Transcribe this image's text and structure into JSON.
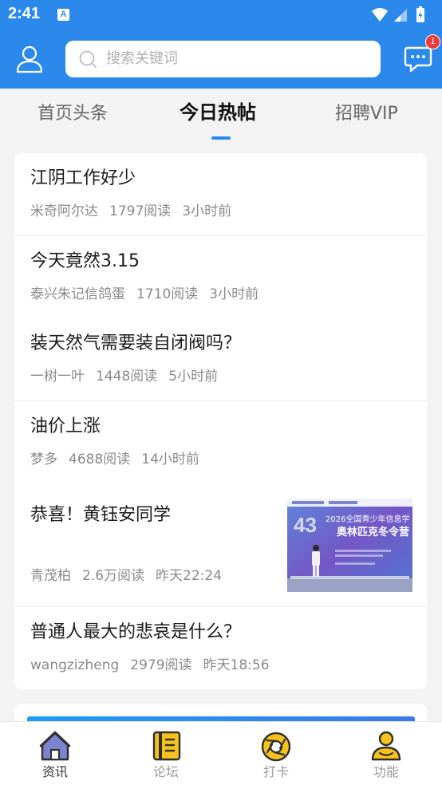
{
  "status_bar": {
    "time": "2:41",
    "app_icon_letter": "A"
  },
  "header": {
    "search": {
      "placeholder": "搜索关键词"
    },
    "message_badge": "1",
    "accent_color": "#2b89ec"
  },
  "tabs": [
    {
      "label": "首页头条",
      "active": false
    },
    {
      "label": "今日热帖",
      "active": true
    },
    {
      "label": "招聘VIP",
      "active": false
    }
  ],
  "posts": [
    {
      "title": "江阴工作好少",
      "author": "米奇阿尔达",
      "reads": "1797阅读",
      "time": "3小时前"
    },
    {
      "title": "今天竟然3.15",
      "author": "泰兴朱记信鸽蛋",
      "reads": "1710阅读",
      "time": "3小时前"
    },
    {
      "title": "装天然气需要装自闭阀吗？",
      "author": "一树一叶",
      "reads": "1448阅读",
      "time": "5小时前"
    },
    {
      "title": "油价上涨",
      "author": "梦多",
      "reads": "4688阅读",
      "time": "14小时前"
    },
    {
      "title": "恭喜！黄钰安同学",
      "author": "青茂柏",
      "reads": "2.6万阅读",
      "time": "昨天22:24",
      "thumbnail": {
        "big_number": "43",
        "headline_line1": "2026全国青少年信息学",
        "headline_line2": "奥林匹克冬令营"
      }
    },
    {
      "title": "普通人最大的悲哀是什么？",
      "author": "wangzizheng",
      "reads": "2979阅读",
      "time": "昨天18:56"
    }
  ],
  "bottom_nav": [
    {
      "label": "资讯",
      "icon": "home-icon",
      "active": true
    },
    {
      "label": "论坛",
      "icon": "forum-icon",
      "active": false
    },
    {
      "label": "打卡",
      "icon": "camera-aperture-icon",
      "active": false
    },
    {
      "label": "功能",
      "icon": "person-icon",
      "active": false
    }
  ]
}
